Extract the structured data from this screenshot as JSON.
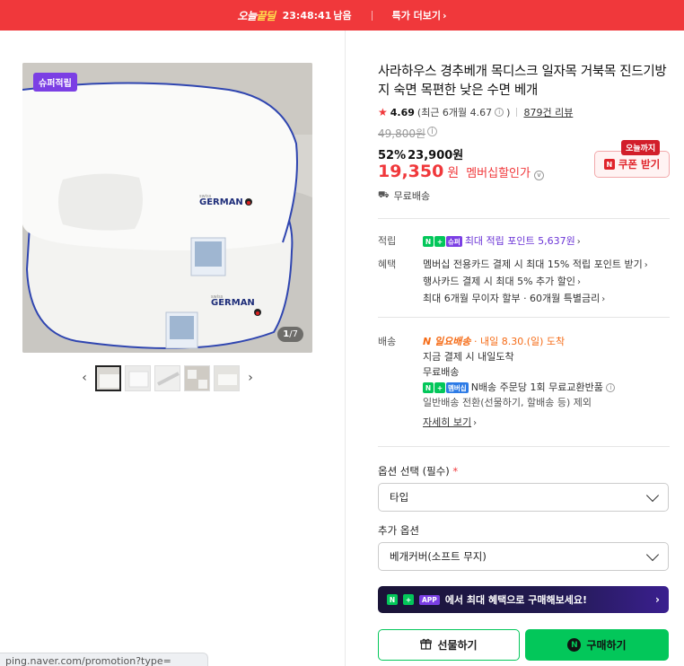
{
  "topbar": {
    "brand_prefix": "오늘",
    "brand_highlight": "끝딜",
    "timer": "23:48:41",
    "timer_suffix": "남음",
    "more_label": "특가 더보기",
    "colors": {
      "background": "#f0383b",
      "highlight": "#ffe14d"
    }
  },
  "gallery": {
    "badge": "슈퍼적립",
    "counter_current": "1",
    "counter_total": "/7",
    "thumbnails_count": 5,
    "selected_thumbnail": 1
  },
  "product": {
    "title": "사라하우스 경추베개 목디스크 일자목 거북목 진드기방지 숙면 목편한 낮은 수면 베개",
    "rating": "4.69",
    "rating_recent": "(최근 6개월 4.67",
    "rating_recent_end": ")",
    "reviews": "879건 리뷰",
    "original_price": "49,800원",
    "discount_percent": "52%",
    "sale_price": "23,900원",
    "member_price": "19,350",
    "member_won": "원",
    "member_label": "멤버십할인가",
    "coupon_tag": "오늘까지",
    "coupon_label": "쿠폰 받기",
    "shipping": "무료배송"
  },
  "benefits": {
    "points_key": "적립",
    "points_chip": "슈퍼",
    "points_text": "최대 적립 포인트 5,637원",
    "benefit_key": "혜택",
    "benefit_lines": [
      "멤버십 전용카드 결제 시 최대 15% 적립 포인트 받기",
      "행사카드 결제 시 최대 5% 추가 할인",
      "최대 6개월 무이자 할부 · 60개월 특별금리"
    ]
  },
  "delivery": {
    "key": "배송",
    "badge": "N 일요배송",
    "arrival": "· 내일 8.30.(일) 도착",
    "line1": "지금 결제 시 내일도착",
    "line2": "무료배송",
    "membership_chip": "멤버십",
    "line3": "N배송 주문당 1회 무료교환반품",
    "line4": "일반배송 전환(선물하기, 할배송 등) 제외",
    "detail_link": "자세히 보기"
  },
  "options": {
    "label1": "옵션 선택 (필수)",
    "required_mark": "*",
    "select1": "타입",
    "label2": "추가 옵션",
    "select2": "베개커버(소프트 무지)"
  },
  "promo_banner": {
    "app_chip": "APP",
    "text": "에서 최대 혜택으로 구매해보세요!"
  },
  "actions": {
    "gift_label": "선물하기",
    "buy_label": "구매하기",
    "brand_color": "#03c75a"
  },
  "status_url": "ping.naver.com/promotion?type="
}
